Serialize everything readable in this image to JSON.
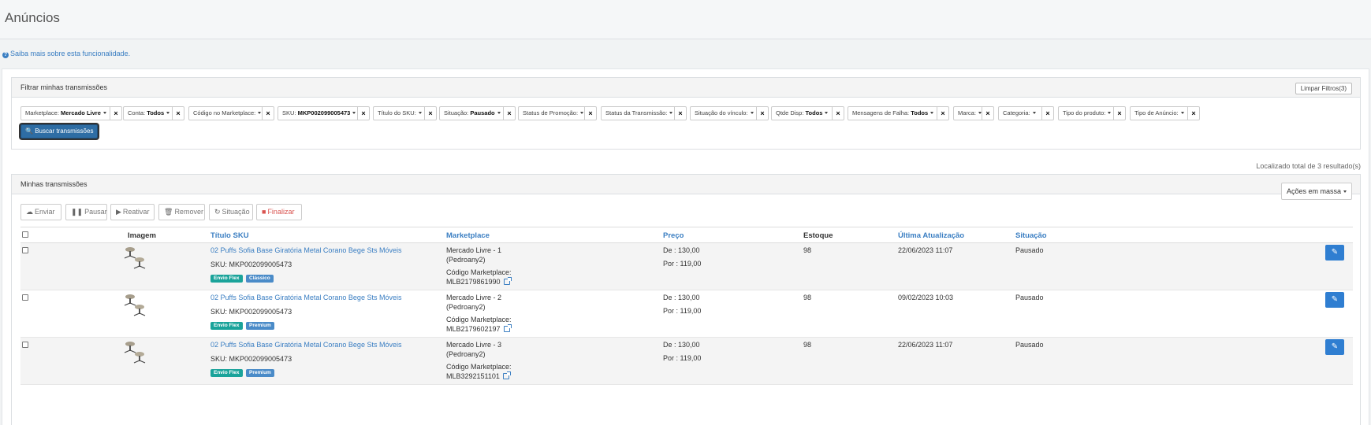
{
  "header": {
    "title": "Anúncios"
  },
  "help_link": "Saiba mais sobre esta funcionalidade.",
  "filters": {
    "title": "Filtrar minhas transmissões",
    "clear_label": "Limpar Filtros(3)",
    "search_label": "Buscar transmissões",
    "chips": [
      {
        "label": "Marketplace:",
        "value": "Mercado Livre"
      },
      {
        "label": "Conta:",
        "value": "Todos"
      },
      {
        "label": "Código no Marketplace:",
        "value": ""
      },
      {
        "label": "SKU:",
        "value": "MKP002099005473"
      },
      {
        "label": "Título do SKU:",
        "value": ""
      },
      {
        "label": "Situação:",
        "value": "Pausado"
      },
      {
        "label": "Status de Promoção:",
        "value": ""
      },
      {
        "label": "Status da Transmissão:",
        "value": ""
      },
      {
        "label": "Situação do vínculo:",
        "value": ""
      },
      {
        "label": "Qtde Disp:",
        "value": "Todos"
      },
      {
        "label": "Mensagens de Falha:",
        "value": "Todos"
      },
      {
        "label": "Marca:",
        "value": ""
      },
      {
        "label": "Categoria:",
        "value": ""
      },
      {
        "label": "Tipo do produto:",
        "value": ""
      },
      {
        "label": "Tipo de Anúncio:",
        "value": ""
      }
    ]
  },
  "results": {
    "count_text": "Localizado total de 3 resultado(s)"
  },
  "list": {
    "title": "Minhas transmissões",
    "toolbar": {
      "send": "Enviar",
      "pause": "Pausar",
      "reactivate": "Reativar",
      "remove": "Remover",
      "status": "Situação",
      "finish": "Finalizar"
    },
    "bulk_actions": "Ações em massa",
    "columns": {
      "image": "Imagem",
      "title": "Título SKU",
      "marketplace": "Marketplace",
      "price": "Preço",
      "stock": "Estoque",
      "updated": "Última Atualização",
      "status": "Situação"
    },
    "rows": [
      {
        "title": "02 Puffs Sofia Base Giratória Metal Corano Bege Sts Móveis",
        "sku": "SKU: MKP002099005473",
        "badges": [
          "Envio Flex",
          "Clássico"
        ],
        "marketplace": "Mercado Livre - 1",
        "account": "(Pedroany2)",
        "code_label": "Código Marketplace:",
        "code": "MLB2179861990",
        "price_from": "De : 130,00",
        "price_to": "Por : 119,00",
        "stock": "98",
        "updated": "22/06/2023 11:07",
        "status": "Pausado"
      },
      {
        "title": "02 Puffs Sofia Base Giratória Metal Corano Bege Sts Móveis",
        "sku": "SKU: MKP002099005473",
        "badges": [
          "Envio Flex",
          "Premium"
        ],
        "marketplace": "Mercado Livre - 2",
        "account": "(Pedroany2)",
        "code_label": "Código Marketplace:",
        "code": "MLB2179602197",
        "price_from": "De : 130,00",
        "price_to": "Por : 119,00",
        "stock": "98",
        "updated": "09/02/2023 10:03",
        "status": "Pausado"
      },
      {
        "title": "02 Puffs Sofia Base Giratória Metal Corano Bege Sts Móveis",
        "sku": "SKU: MKP002099005473",
        "badges": [
          "Envio Flex",
          "Premium"
        ],
        "marketplace": "Mercado Livre - 3",
        "account": "(Pedroany2)",
        "code_label": "Código Marketplace:",
        "code": "MLB3292151101",
        "price_from": "De : 130,00",
        "price_to": "Por : 119,00",
        "stock": "98",
        "updated": "22/06/2023 11:07",
        "status": "Pausado"
      }
    ]
  }
}
